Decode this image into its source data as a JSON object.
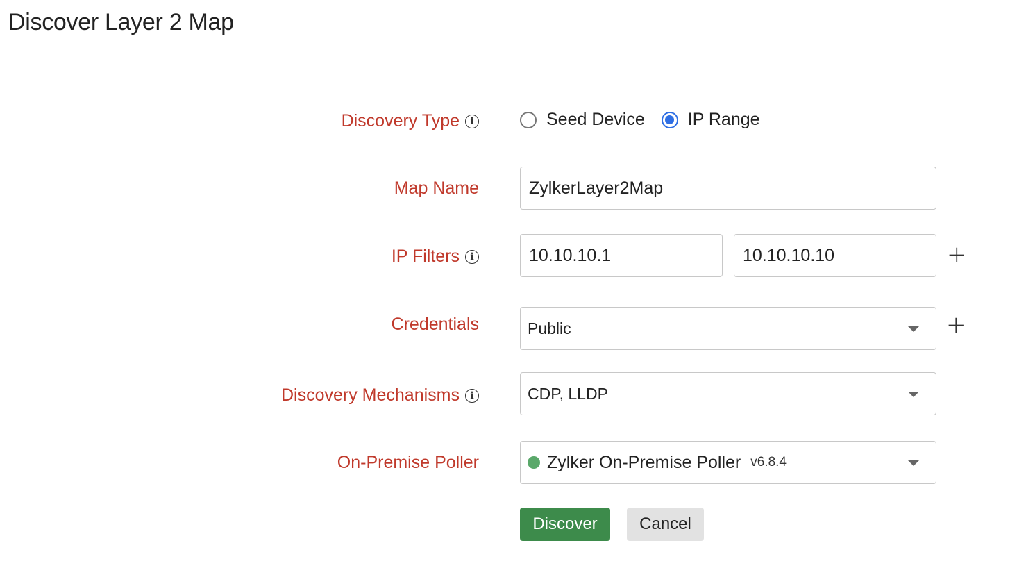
{
  "page": {
    "title": "Discover Layer 2 Map"
  },
  "form": {
    "discovery_type": {
      "label": "Discovery Type",
      "options": [
        {
          "label": "Seed Device",
          "checked": false
        },
        {
          "label": "IP Range",
          "checked": true
        }
      ]
    },
    "map_name": {
      "label": "Map Name",
      "value": "ZylkerLayer2Map"
    },
    "ip_filters": {
      "label": "IP Filters",
      "start": "10.10.10.1",
      "end": "10.10.10.10"
    },
    "credentials": {
      "label": "Credentials",
      "value": "Public"
    },
    "discovery_mechanisms": {
      "label": "Discovery Mechanisms",
      "value": "CDP, LLDP"
    },
    "poller": {
      "label": "On-Premise Poller",
      "value": "Zylker On-Premise Poller",
      "version": "v6.8.4",
      "status_color": "#5aa86a"
    }
  },
  "actions": {
    "discover_label": "Discover",
    "cancel_label": "Cancel"
  },
  "icons": {
    "info": "info-icon",
    "add": "plus-icon",
    "dropdown": "chevron-down-icon"
  },
  "colors": {
    "label": "#c0392b",
    "primary": "#3d8b4b",
    "radio_active": "#2f6fe4"
  }
}
